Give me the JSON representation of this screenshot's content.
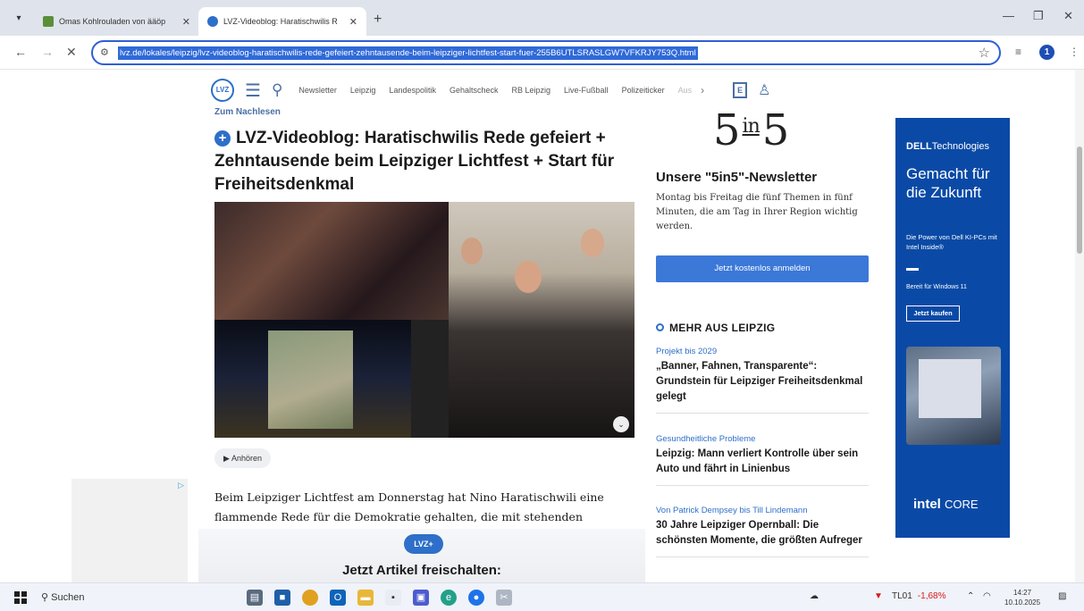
{
  "browser": {
    "tab_menu_icon": "chevron-down-icon",
    "tabs": [
      {
        "label": "Omas Kohlrouladen von ääöp",
        "favicon_color": "#5a8f3a"
      },
      {
        "label": "LVZ-Videoblog: Haratischwilis R",
        "favicon_color": "#2e6fc9"
      }
    ],
    "new_tab": "+",
    "url": "lvz.de/lokales/leipzig/lvz-videoblog-haratischwilis-rede-gefeiert-zehntausende-beim-leipziger-lichtfest-start-fuer-255B6UTLSRASLGW7VFKRJY753Q.html",
    "profile_initial": "1"
  },
  "site": {
    "logo": "LVZ",
    "nav_items": [
      "Newsletter",
      "Leipzig",
      "Landespolitik",
      "Gehaltscheck",
      "RB Leipzig",
      "Live-Fußball",
      "Polizeiticker",
      "Aus"
    ],
    "epaper": "E"
  },
  "article": {
    "kicker": "Zum Nachlesen",
    "headline": "LVZ-Videoblog: Haratischwilis Rede gefeiert + Zehntausende beim Leipziger Lichtfest + Start für Freiheitsdenkmal",
    "listen_label": "Anhören",
    "lede": "Beim Leipziger Lichtfest am Donnerstag hat Nino Haratischwili eine flammende Rede für die Demokratie gehalten, die mit stehenden Ovationen",
    "paywall_logo": "LVZ+",
    "paywall_title": "Jetzt Artikel freischalten:"
  },
  "sidebar": {
    "five_a": "5",
    "five_in": "in",
    "five_b": "5",
    "newsletter_title": "Unsere \"5in5\"-Newsletter",
    "newsletter_text": "Montag bis Freitag die fünf Themen in fünf Minuten, die am Tag in Ihrer Region wichtig werden.",
    "newsletter_button": "Jetzt kostenlos anmelden",
    "more_heading": "MEHR AUS LEIPZIG",
    "teasers": [
      {
        "kicker": "Projekt bis 2029",
        "title": "„Banner, Fahnen, Transparente“: Grundstein für Leipziger Freiheitsdenkmal gelegt"
      },
      {
        "kicker": "Gesundheitliche Probleme",
        "title": "Leipzig: Mann verliert Kontrolle über sein Auto und fährt in Linienbus"
      },
      {
        "kicker": "Von Patrick Dempsey bis Till Lindemann",
        "title": "30 Jahre Leipziger Opernball: Die schönsten Momente, die größten Aufreger"
      }
    ]
  },
  "ad": {
    "brand": "DELL",
    "brand_sub": "Technologies",
    "claim": "Gemacht für die Zukunft",
    "sub": "Die Power von Dell KI-PCs mit Intel Inside®",
    "windows": "Bereit für Windows 11",
    "button": "Jetzt kaufen",
    "intel": "intel",
    "intel_sub": "CORE"
  },
  "taskbar": {
    "search": "Suchen",
    "stock_name": "TL01",
    "stock_change": "-1,68%",
    "time": "14:27",
    "date": "10.10.2025"
  }
}
